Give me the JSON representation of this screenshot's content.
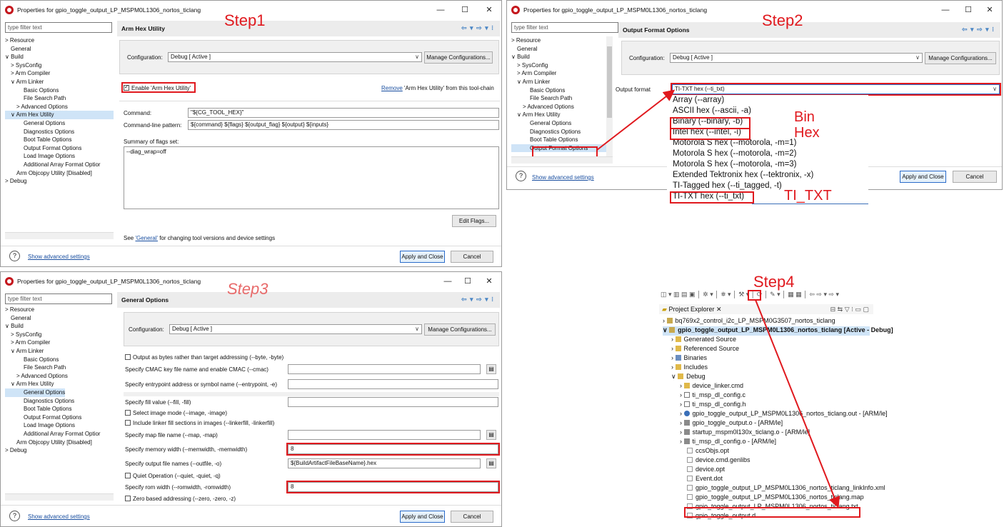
{
  "window_title": "Properties for gpio_toggle_output_LP_MSPM0L1306_nortos_ticlang",
  "filter_placeholder": "type filter text",
  "steps": {
    "s1": "Step1",
    "s2": "Step2",
    "s3": "Step3",
    "s4": "Step4"
  },
  "window_buttons": {
    "min": "—",
    "max": "☐",
    "close": "✕"
  },
  "nav_icons": "⇦ ▾ ⇨ ▾ ⁝",
  "tree": {
    "resource": "> Resource",
    "general": "General",
    "build": "∨ Build",
    "sysconfig": "> SysConfig",
    "arm_compiler": "> Arm Compiler",
    "arm_linker": "∨ Arm Linker",
    "basic": "Basic Options",
    "filesearch": "File Search Path",
    "advanced": "> Advanced Options",
    "hex": "∨ Arm Hex Utility",
    "hex_general": "General Options",
    "diag": "Diagnostics Options",
    "boot": "Boot Table Options",
    "output_fmt": "Output Format Options",
    "load_img": "Load Image Options",
    "add_array": "Additional Array Format Optior",
    "objcopy": "Arm Objcopy Utility  [Disabled]",
    "debug": "> Debug",
    "output_fmt_clipped": "Output Format Options"
  },
  "common": {
    "config_label": "Configuration:",
    "config_value": "Debug  [ Active ]",
    "manage": "Manage Configurations...",
    "show_adv": "Show advanced settings",
    "apply": "Apply and Close",
    "cancel": "Cancel",
    "help": "?"
  },
  "d1": {
    "header": "Arm Hex Utility",
    "enable": "Enable 'Arm Hex Utility'",
    "remove_link": "Remove",
    "remove_text": " 'Arm Hex Utility' from this tool-chain",
    "command_label": "Command:",
    "command_value": "\"${CG_TOOL_HEX}\"",
    "pattern_label": "Command-line pattern:",
    "pattern_value": "${command} ${flags} ${output_flag} ${output} ${inputs}",
    "summary_label": "Summary of flags set:",
    "summary_value": "--diag_wrap=off",
    "edit_flags": "Edit Flags...",
    "see": "See ",
    "see_link": "'General'",
    "see_rest": " for changing tool versions and device settings"
  },
  "d2": {
    "header": "Output Format Options",
    "format_label": "Output format",
    "format_value": "TI-TXT hex (--ti_txt)",
    "options": [
      "Array (--array)",
      "ASCII hex (--ascii, -a)",
      "Binary (--binary, -b)",
      "Intel hex (--intel, -i)",
      "Motorola S hex (--motorola, -m=1)",
      "Motorola S hex (--motorola, -m=2)",
      "Motorola S hex (--motorola, -m=3)",
      "Extended Tektronix hex (--tektronix, -x)",
      "TI-Tagged hex (--ti_tagged, -t)",
      "TI-TXT hex (--ti_txt)"
    ],
    "ann_bin": "Bin",
    "ann_hex": "Hex",
    "ann_titxt": "TI_TXT"
  },
  "d3": {
    "header": "General Options",
    "byte": "Output as bytes rather than target addressing (--byte, -byte)",
    "cmac": "Specify CMAC key file name and enable CMAC (--cmac)",
    "entry": "Specify entrypoint address or symbol name (--entrypoint, -e)",
    "fill": "Specify fill value (--fill, -fill)",
    "image": "Select image mode (--image, -image)",
    "linkerfill": "Include linker fill sections in images (--linkerfill, -linkerfill)",
    "map": "Specify map file name (--map, -map)",
    "memwidth": "Specify memory width (--memwidth, -memwidth)",
    "memwidth_value": "8",
    "outfile": "Specify output file names (--outfile, -o)",
    "outfile_value": "${BuildArtifactFileBaseName}.hex",
    "quiet": "Quiet Operation (--quiet, -quiet, -q)",
    "romwidth": "Specify rom width (--romwidth, -romwidth)",
    "romwidth_value": "8",
    "zero": "Zero based addressing (--zero, -zero, -z)"
  },
  "pe": {
    "title": "Project Explorer",
    "toolbar": "◫ ▾ ▥ ▤ ▣ │ ✲ ▾ │ ⛯ ▾ │ ⚒ ▾ │ ⟳ │ ✎ ▾ │ ▦ ▦ │ ⇦ ⇨ ▾ ⇨ ▾",
    "toolbar_right": "⊟ ⇆ ▽ ⁝ ▭ ▢",
    "items": [
      "bq769x2_control_i2c_LP_MSPM0G3507_nortos_ticlang",
      "gpio_toggle_output_LP_MSPM0L1306_nortos_ticlang  [Active - Debug]",
      "Generated Source",
      "Referenced Source",
      "Binaries",
      "Includes",
      "Debug",
      "device_linker.cmd",
      "ti_msp_dl_config.c",
      "ti_msp_dl_config.h",
      "gpio_toggle_output_LP_MSPM0L1306_nortos_ticlang.out - [ARM/le]",
      "gpio_toggle_output.o - [ARM/le]",
      "startup_mspm0l130x_ticlang.o - [ARM/le]",
      "ti_msp_dl_config.o - [ARM/le]",
      "ccsObjs.opt",
      "device.cmd.genlibs",
      "device.opt",
      "Event.dot",
      "gpio_toggle_output_LP_MSPM0L1306_nortos_ticlang_linkInfo.xml",
      "gpio_toggle_output_LP_MSPM0L1306_nortos_ticlang.map",
      "gpio_toggle_output_LP_MSPM0L1306_nortos_ticlang.txt",
      "gpio_toggle_output.d"
    ]
  }
}
